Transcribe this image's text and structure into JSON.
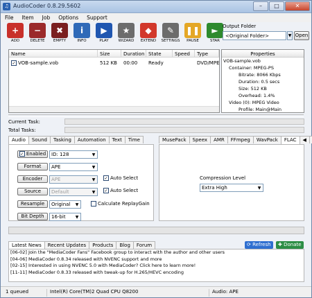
{
  "window": {
    "title": "AudioCoder 0.8.29.5602",
    "buttons": [
      "–",
      "□",
      "✕"
    ]
  },
  "menu": [
    "File",
    "Item",
    "Job",
    "Options",
    "Support"
  ],
  "toolbar": [
    {
      "label": "ADD",
      "icon": "add-icon",
      "glyph": "+",
      "color": "#c8302a"
    },
    {
      "label": "DELETE",
      "icon": "delete-icon",
      "glyph": "−",
      "color": "#9b2a2a"
    },
    {
      "label": "EMPTY",
      "icon": "empty-icon",
      "glyph": "✖",
      "color": "#7a1f1f"
    },
    {
      "label": "INFO",
      "icon": "info-icon",
      "glyph": "i",
      "color": "#2f6ab8"
    },
    {
      "label": "PLAY",
      "icon": "play-icon",
      "glyph": "▶",
      "color": "#1f56b0"
    },
    {
      "label": "WIZARD",
      "icon": "wizard-icon",
      "glyph": "★",
      "color": "#6c6c6c"
    },
    {
      "label": "EXTEND",
      "icon": "extend-icon",
      "glyph": "◆",
      "color": "#d2382b"
    },
    {
      "label": "SETTINGS",
      "icon": "settings-icon",
      "glyph": "✎",
      "color": "#6c6c6c"
    },
    {
      "label": "PAUSE",
      "icon": "pause-icon",
      "glyph": "❚❚",
      "color": "#e4a726"
    },
    {
      "label": "STAR",
      "icon": "start-icon",
      "glyph": "►",
      "color": "#2e8a2e"
    }
  ],
  "output_folder": {
    "label": "Output Folder",
    "value": "<Original Folder>",
    "open": "Open"
  },
  "file_list": {
    "columns": [
      "Name",
      "Size",
      "Duration",
      "State",
      "Speed",
      "Type"
    ],
    "rows": [
      {
        "name": "VOB-sample.vob",
        "size": "512 KB",
        "duration": "00:00",
        "state": "Ready",
        "speed": "",
        "type": "DVD/MPEG:"
      }
    ]
  },
  "properties": {
    "header": "Properties",
    "lines": [
      "VOB-sample.vob",
      "Container: MPEG-PS",
      "Bitrate: 8066 Kbps",
      "Duration: 0.5 secs",
      "Size: 512 KB",
      "Overhead: 1.4%",
      "Video (0): MPEG Video",
      "Profile: Main@Main"
    ]
  },
  "tasks": {
    "current": "Current Task:",
    "total": "Total Tasks:"
  },
  "left_tabs": [
    "Audio",
    "Sound",
    "Tasking",
    "Automation",
    "Text",
    "Time"
  ],
  "right_tabs": [
    "MusePack",
    "Speex",
    "AMR",
    "FFmpeg",
    "WavPack",
    "FLAC"
  ],
  "audio": {
    "enabled_label": "Enabled",
    "id_value": "ID: 128",
    "format_label": "Format",
    "format_value": "APE",
    "encoder_label": "Encoder",
    "encoder_value": "APE",
    "source_label": "Source",
    "source_value": "Default",
    "resample_label": "Resample",
    "resample_value": "Original",
    "bitdepth_label": "Bit Depth",
    "bitdepth_value": "16-bit",
    "auto_select_1": "Auto Select",
    "auto_select_2": "Auto Select",
    "replaygain": "Calculate ReplayGain"
  },
  "compression": {
    "label": "Compression Level",
    "value": "Extra High"
  },
  "news_tabs": [
    "Latest News",
    "Recent Updates",
    "Products",
    "Blog",
    "Forum"
  ],
  "refresh": "Refresh",
  "donate": "Donate",
  "news": [
    "[06-02] Join the \"MediaCoder Fans\" Facebook group to interact with the author and other users",
    "[04-06] MediaCoder 0.8.34 released with NVENC support and more",
    "[02-15] Interested in using NVENC 5.0 with MediaCoder? Click here to learn more!",
    "[11-11] MediaCoder 0.8.33 released with tweak-up for H.265/HEVC encoding"
  ],
  "status": {
    "queued": "1 queued",
    "cpu": "Intel(R) Core(TM)2 Quad CPU Q8200",
    "audio": "Audio: APE"
  }
}
